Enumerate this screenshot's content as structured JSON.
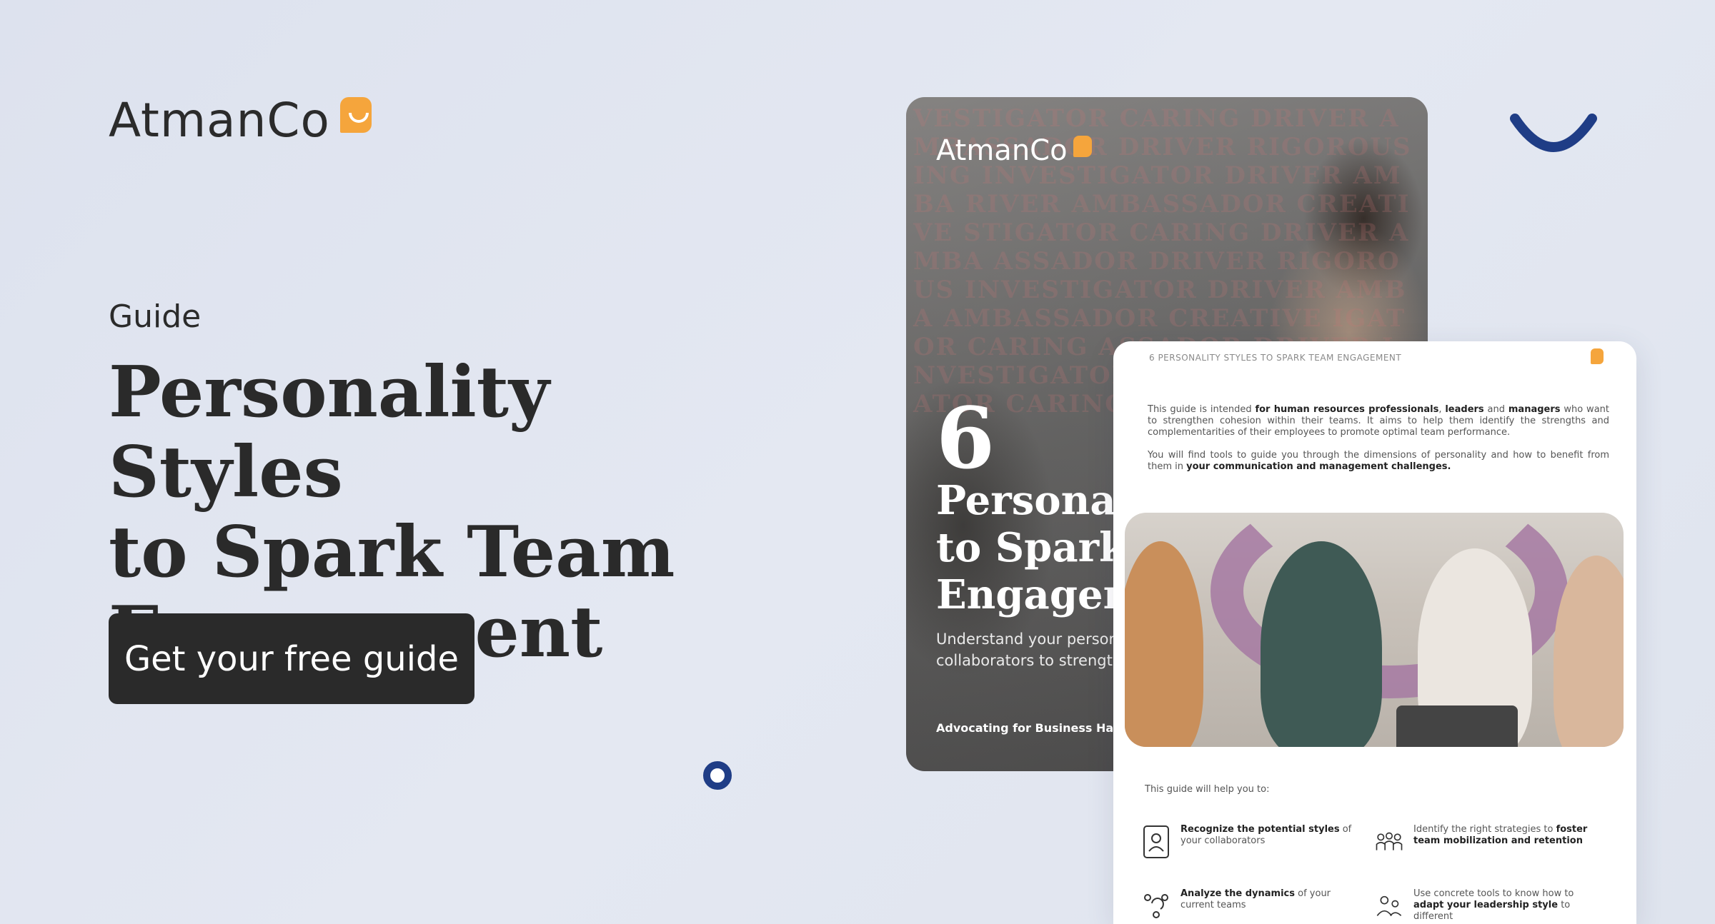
{
  "brand": {
    "name": "AtmanCo",
    "accent": "#f5a53c",
    "navy": "#1f3d86"
  },
  "hero": {
    "eyebrow": "Guide",
    "title": "Personality Styles\n to Spark Team\nEngagement",
    "cta_label": "Get your free guide"
  },
  "cover": {
    "logo": "AtmanCo",
    "background_words": "VESTIGATOR CARING DRIVER AMBASSADOR DRIVER RIGOROUS ING INVESTIGATOR DRIVER AMBA RIVER AMBASSADOR CREATIVE STIGATOR CARING DRIVER AMBA ASSADOR DRIVER RIGOROUS INVESTIGATOR DRIVER AMBA AMBASSADOR CREATIVE IGATOR CARING ASSADOR DRIVER INVESTIGATOR AMBASSADOR IGATOR CARING DRIVER",
    "number": "6",
    "title": "Personality Styles\nto Spark Team\nEngagement",
    "subtitle": "Understand your personality and that of your\ncollaborators to strengthen team engagement",
    "footer": "Advocating for Business Happiness"
  },
  "page": {
    "header": "6 PERSONALITY STYLES TO SPARK TEAM ENGAGEMENT",
    "intro_1_a": "This guide is intended ",
    "intro_1_b": "for human resources professionals",
    "intro_1_c": ", ",
    "intro_1_d": "leaders",
    "intro_1_e": " and ",
    "intro_1_f": "managers",
    "intro_1_g": " who want to strengthen cohesion within their teams. It aims to help them identify the strengths and complementarities of their employees to promote optimal team performance.",
    "intro_2_a": "You will find tools to guide you through the dimensions of personality and how to benefit from them in ",
    "intro_2_b": "your communication and management challenges.",
    "help_title": "This guide will help you to:",
    "benefits": [
      {
        "bold": "Recognize the potential styles",
        "rest": " of your collaborators",
        "icon": "person-card-icon"
      },
      {
        "pre": "Identify the right strategies to ",
        "bold": "foster team mobilization and retention",
        "icon": "team-icon"
      },
      {
        "bold": "Analyze the dynamics",
        "rest": " of your current teams",
        "icon": "cycle-people-icon"
      },
      {
        "pre": "Use concrete tools to know how to ",
        "bold": "adapt your leadership style",
        "rest": " to different",
        "icon": "leader-icon"
      }
    ]
  }
}
